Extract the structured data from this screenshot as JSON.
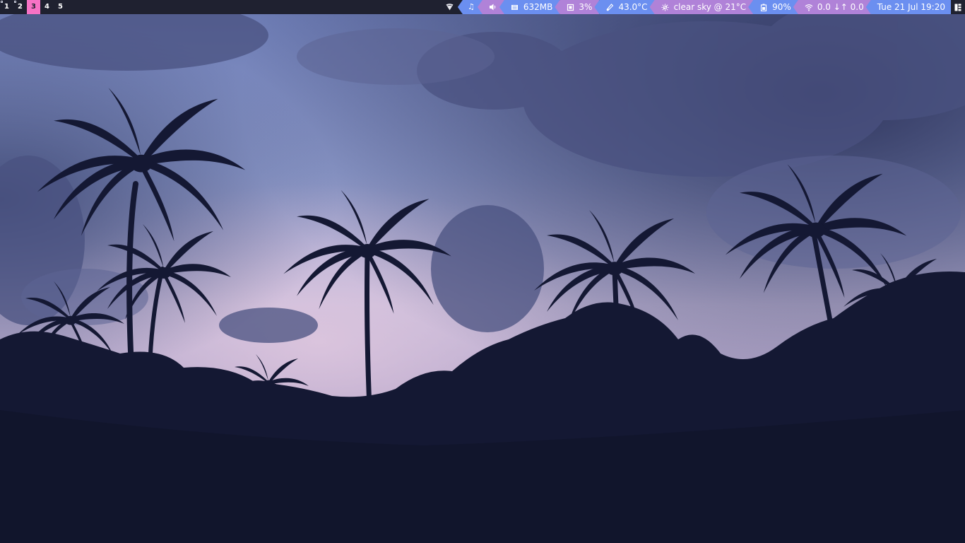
{
  "tags": [
    {
      "label": "1",
      "active": false,
      "occupied": true
    },
    {
      "label": "2",
      "active": false,
      "occupied": true
    },
    {
      "label": "3",
      "active": true,
      "occupied": false
    },
    {
      "label": "4",
      "active": false,
      "occupied": false
    },
    {
      "label": "5",
      "active": false,
      "occupied": false
    }
  ],
  "widgets": {
    "music": {
      "icon": "music-note-icon"
    },
    "volume": {
      "icon": "speaker-icon"
    },
    "memory": {
      "icon": "memory-icon",
      "text": "632MB"
    },
    "cpu": {
      "icon": "cpu-icon",
      "text": "3%"
    },
    "temperature": {
      "icon": "thermometer-icon",
      "text": "43.0°C"
    },
    "weather": {
      "icon": "weather-icon",
      "text": "clear sky @ 21°C"
    },
    "battery": {
      "icon": "battery-icon",
      "text": "90%"
    },
    "network": {
      "icon": "wifi-icon",
      "text": "0.0 ↓↑ 0.0"
    },
    "clock": {
      "text": "Tue 21 Jul 19:20"
    }
  },
  "colors": {
    "bar_bg": "#1f2130",
    "tag_active": "#f772c5",
    "segment_blue": "#6b8ff0",
    "segment_purple": "#b082d8"
  },
  "wallpaper": {
    "icon": "palm-trees-dusk-wallpaper"
  }
}
